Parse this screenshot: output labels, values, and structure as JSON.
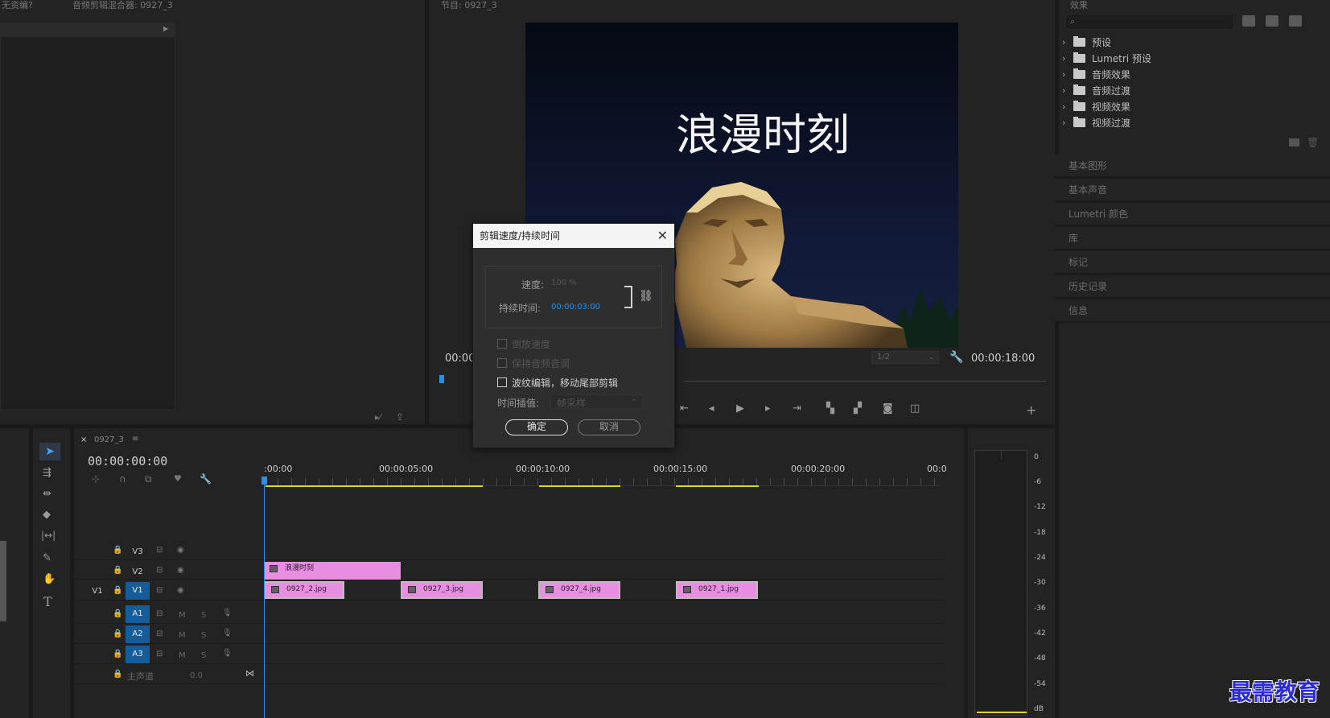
{
  "panels": {
    "source_tab_1": "无资编?",
    "source_tab_2": "音频剪辑混合器: 0927_3",
    "program_tab": "节目: 0927_3",
    "effects_tab": "效果",
    "timeline_tab": "0927_3"
  },
  "program": {
    "title_text": "浪漫时刻",
    "timecode_left": "00:00",
    "resolution": "1/2",
    "timecode_right": "00:00:18:00"
  },
  "effects": {
    "search_placeholder": "",
    "items": [
      {
        "label": "预设",
        "icon": "preset-folder-icon"
      },
      {
        "label": "Lumetri 预设",
        "icon": "preset-folder-icon"
      },
      {
        "label": "音频效果",
        "icon": "folder-icon"
      },
      {
        "label": "音频过渡",
        "icon": "folder-icon"
      },
      {
        "label": "视频效果",
        "icon": "folder-icon"
      },
      {
        "label": "视频过渡",
        "icon": "folder-icon"
      }
    ]
  },
  "side_panels": [
    "基本图形",
    "基本声音",
    "Lumetri 颜色",
    "库",
    "标记",
    "历史记录",
    "信息"
  ],
  "timeline": {
    "timecode": "00:00:00:00",
    "ruler": [
      ":00:00",
      "00:00:05:00",
      "00:00:10:00",
      "00:00:15:00",
      "00:00:20:00",
      "00:0"
    ],
    "tracks": {
      "v3": "V3",
      "v2": "V2",
      "v1": "V1",
      "v1_src": "V1",
      "a1": "A1",
      "a2": "A2",
      "a3": "A3",
      "m": "M",
      "s": "S",
      "master": "主声道",
      "master_level": "0.0"
    },
    "title_clip": "浪漫时刻",
    "clips": [
      "0927_2.jpg",
      "0927_3.jpg",
      "0927_4.jpg",
      "0927_1.jpg"
    ]
  },
  "meter": {
    "labels": [
      "0",
      "-6",
      "-12",
      "-18",
      "-24",
      "-30",
      "-36",
      "-42",
      "-48",
      "-54",
      "dB"
    ]
  },
  "dialog": {
    "title": "剪辑速度/持续时间",
    "speed_label": "速度:",
    "speed_value": "100 %",
    "duration_label": "持续时间:",
    "duration_value": "00:00:03:00",
    "reverse_label": "倒放速度",
    "pitch_label": "保持音频音调",
    "ripple_label": "波纹编辑，移动尾部剪辑",
    "interp_label": "时间插值:",
    "interp_value": "帧采样",
    "ok": "确定",
    "cancel": "取消"
  },
  "watermark": "最需教育",
  "colors": {
    "accent_blue": "#2b8fe8",
    "clip_pink": "#e88ee0",
    "track_blue": "#155d9a",
    "work_area_yellow": "#e6d31e"
  }
}
